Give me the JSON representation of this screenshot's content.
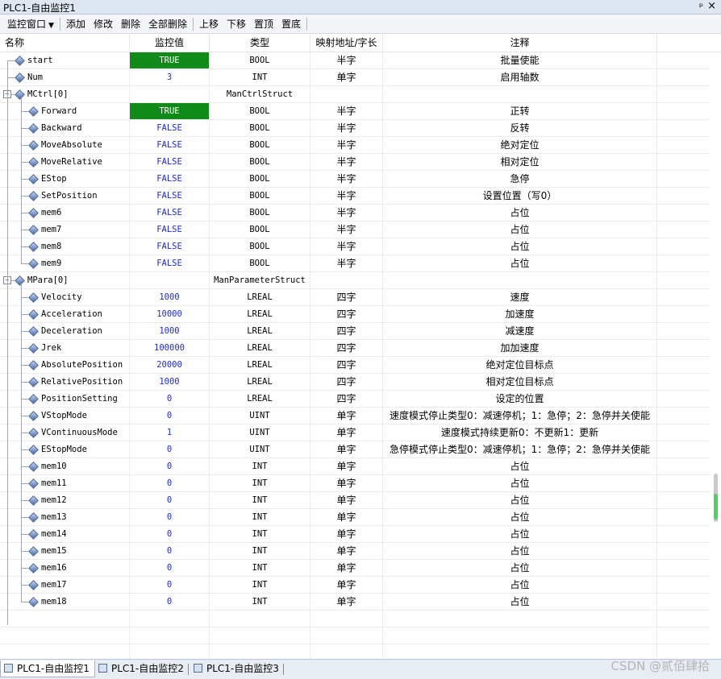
{
  "window": {
    "title": "PLC1-自由监控1",
    "pin_glyph": "ᵖ",
    "close_glyph": "×"
  },
  "toolbar": {
    "items": [
      "监控窗口",
      "添加",
      "修改",
      "删除",
      "全部删除",
      "上移",
      "下移",
      "置顶",
      "置底"
    ]
  },
  "columns": {
    "name": "名称",
    "value": "监控值",
    "type": "类型",
    "map": "映射地址/字长",
    "note": "注释"
  },
  "rows": [
    {
      "name": "start",
      "value": "TRUE",
      "type": "BOOL",
      "map": "半字",
      "note": "批量使能",
      "level": 0
    },
    {
      "name": "Num",
      "value": "3",
      "type": "INT",
      "map": "单字",
      "note": "启用轴数",
      "level": 0
    },
    {
      "name": "MCtrl[0]",
      "value": "",
      "type": "ManCtrlStruct",
      "map": "",
      "note": "",
      "level": 0,
      "group": true
    },
    {
      "name": "Forward",
      "value": "TRUE",
      "type": "BOOL",
      "map": "半字",
      "note": "正转",
      "level": 1
    },
    {
      "name": "Backward",
      "value": "FALSE",
      "type": "BOOL",
      "map": "半字",
      "note": "反转",
      "level": 1
    },
    {
      "name": "MoveAbsolute",
      "value": "FALSE",
      "type": "BOOL",
      "map": "半字",
      "note": "绝对定位",
      "level": 1
    },
    {
      "name": "MoveRelative",
      "value": "FALSE",
      "type": "BOOL",
      "map": "半字",
      "note": "相对定位",
      "level": 1
    },
    {
      "name": "EStop",
      "value": "FALSE",
      "type": "BOOL",
      "map": "半字",
      "note": "急停",
      "level": 1
    },
    {
      "name": "SetPosition",
      "value": "FALSE",
      "type": "BOOL",
      "map": "半字",
      "note": "设置位置（写0）",
      "level": 1
    },
    {
      "name": "mem6",
      "value": "FALSE",
      "type": "BOOL",
      "map": "半字",
      "note": "占位",
      "level": 1
    },
    {
      "name": "mem7",
      "value": "FALSE",
      "type": "BOOL",
      "map": "半字",
      "note": "占位",
      "level": 1
    },
    {
      "name": "mem8",
      "value": "FALSE",
      "type": "BOOL",
      "map": "半字",
      "note": "占位",
      "level": 1
    },
    {
      "name": "mem9",
      "value": "FALSE",
      "type": "BOOL",
      "map": "半字",
      "note": "占位",
      "level": 1
    },
    {
      "name": "MPara[0]",
      "value": "",
      "type": "ManParameterStruct",
      "map": "",
      "note": "",
      "level": 0,
      "group": true
    },
    {
      "name": "Velocity",
      "value": "1000",
      "type": "LREAL",
      "map": "四字",
      "note": "速度",
      "level": 1
    },
    {
      "name": "Acceleration",
      "value": "10000",
      "type": "LREAL",
      "map": "四字",
      "note": "加速度",
      "level": 1
    },
    {
      "name": "Deceleration",
      "value": "1000",
      "type": "LREAL",
      "map": "四字",
      "note": "减速度",
      "level": 1
    },
    {
      "name": "Jrek",
      "value": "100000",
      "type": "LREAL",
      "map": "四字",
      "note": "加加速度",
      "level": 1
    },
    {
      "name": "AbsolutePosition",
      "value": "20000",
      "type": "LREAL",
      "map": "四字",
      "note": "绝对定位目标点",
      "level": 1
    },
    {
      "name": "RelativePosition",
      "value": "1000",
      "type": "LREAL",
      "map": "四字",
      "note": "相对定位目标点",
      "level": 1
    },
    {
      "name": "PositionSetting",
      "value": "0",
      "type": "LREAL",
      "map": "四字",
      "note": "设定的位置",
      "level": 1
    },
    {
      "name": "VStopMode",
      "value": "0",
      "type": "UINT",
      "map": "单字",
      "note": "速度模式停止类型0：减速停机；1：急停；2：急停并关使能",
      "level": 1
    },
    {
      "name": "VContinuousMode",
      "value": "1",
      "type": "UINT",
      "map": "单字",
      "note": "速度模式持续更新0：不更新1：更新",
      "level": 1
    },
    {
      "name": "EStopMode",
      "value": "0",
      "type": "UINT",
      "map": "单字",
      "note": "急停模式停止类型0：减速停机；1：急停；2：急停并关使能",
      "level": 1
    },
    {
      "name": "mem10",
      "value": "0",
      "type": "INT",
      "map": "单字",
      "note": "占位",
      "level": 1
    },
    {
      "name": "mem11",
      "value": "0",
      "type": "INT",
      "map": "单字",
      "note": "占位",
      "level": 1
    },
    {
      "name": "mem12",
      "value": "0",
      "type": "INT",
      "map": "单字",
      "note": "占位",
      "level": 1
    },
    {
      "name": "mem13",
      "value": "0",
      "type": "INT",
      "map": "单字",
      "note": "占位",
      "level": 1
    },
    {
      "name": "mem14",
      "value": "0",
      "type": "INT",
      "map": "单字",
      "note": "占位",
      "level": 1
    },
    {
      "name": "mem15",
      "value": "0",
      "type": "INT",
      "map": "单字",
      "note": "占位",
      "level": 1
    },
    {
      "name": "mem16",
      "value": "0",
      "type": "INT",
      "map": "单字",
      "note": "占位",
      "level": 1
    },
    {
      "name": "mem17",
      "value": "0",
      "type": "INT",
      "map": "单字",
      "note": "占位",
      "level": 1
    },
    {
      "name": "mem18",
      "value": "0",
      "type": "INT",
      "map": "单字",
      "note": "占位",
      "level": 1
    }
  ],
  "tabs": [
    {
      "label": "PLC1-自由监控1",
      "active": true
    },
    {
      "label": "PLC1-自由监控2",
      "active": false
    },
    {
      "label": "PLC1-自由监控3",
      "active": false
    }
  ],
  "colors": {
    "true_bg": "#128a1a",
    "value_blue": "#1f2bd1"
  },
  "watermark": "CSDN @贰佰肆拾"
}
